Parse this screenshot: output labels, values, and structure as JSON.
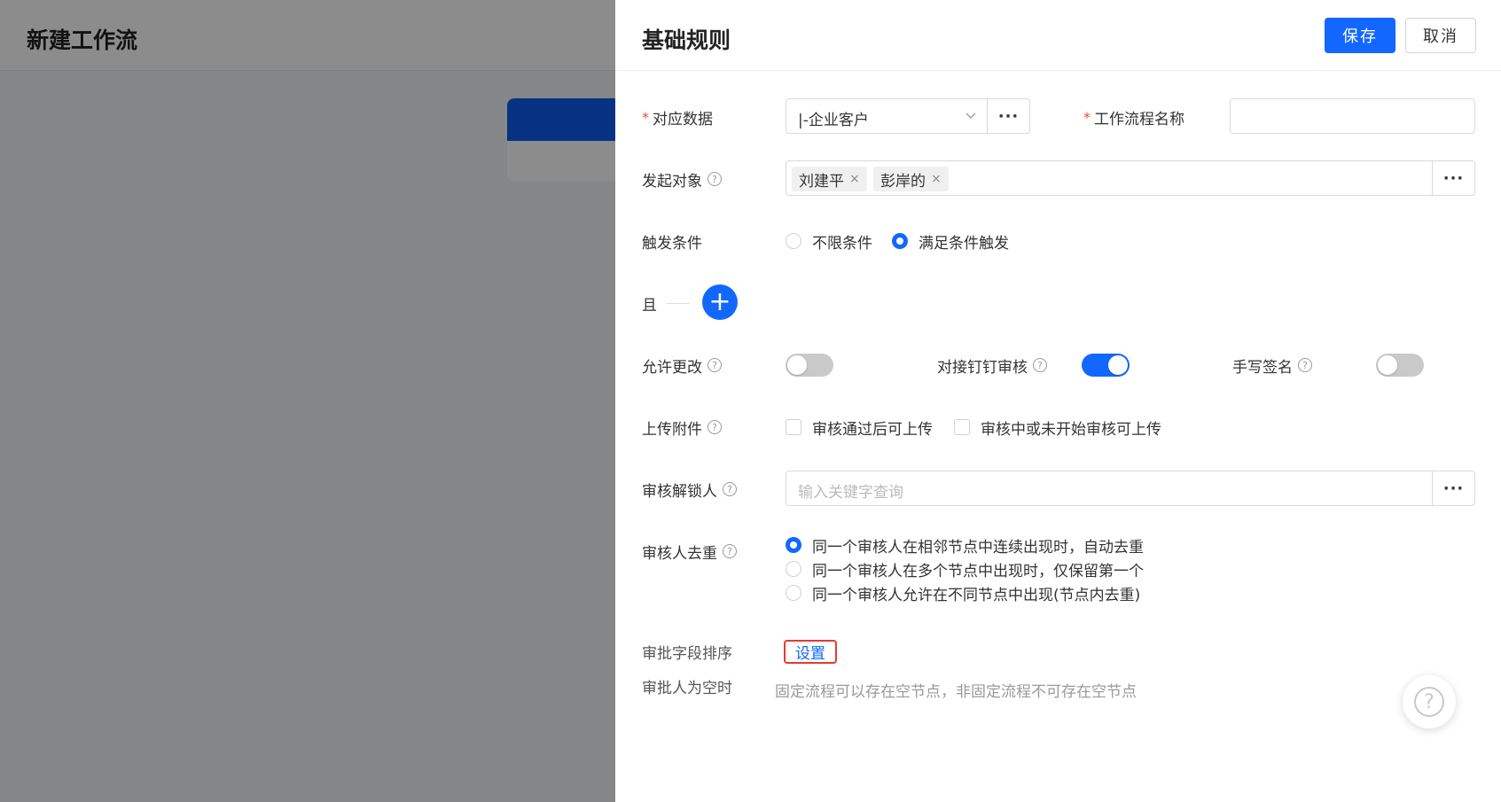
{
  "background": {
    "page_title": "新建工作流"
  },
  "drawer": {
    "title": "基础规则",
    "save_label": "保存",
    "cancel_label": "取消"
  },
  "form": {
    "data_source": {
      "label": "对应数据",
      "value": "|-企业客户",
      "more": "···"
    },
    "workflow_name": {
      "label": "工作流程名称",
      "value": ""
    },
    "initiator": {
      "label": "发起对象",
      "tags": [
        "刘建平",
        "彭岸的"
      ],
      "tag_remove": "×",
      "more": "···"
    },
    "trigger": {
      "label": "触发条件",
      "options": [
        "不限条件",
        "满足条件触发"
      ],
      "selected": 1
    },
    "condition_group": {
      "and_label": "且",
      "add_symbol": "+"
    },
    "allow_modify": {
      "label": "允许更改",
      "on": false
    },
    "dingtalk": {
      "label": "对接钉钉审核",
      "on": true
    },
    "signature": {
      "label": "手写签名",
      "on": false
    },
    "upload": {
      "label": "上传附件",
      "options": [
        "审核通过后可上传",
        "审核中或未开始审核可上传"
      ]
    },
    "unlocker": {
      "label": "审核解锁人",
      "placeholder": "输入关键字查询",
      "more": "···"
    },
    "dedupe": {
      "label": "审核人去重",
      "options": [
        "同一个审核人在相邻节点中连续出现时，自动去重",
        "同一个审核人在多个节点中出现时，仅保留第一个",
        "同一个审核人允许在不同节点中出现(节点内去重)"
      ],
      "selected": 0
    },
    "field_order": {
      "label": "审批字段排序",
      "link": "设置"
    },
    "empty_approver": {
      "label": "审批人为空时",
      "hint": "固定流程可以存在空节点，非固定流程不可存在空节点"
    }
  },
  "help_icon": "?",
  "required_mark": "*"
}
